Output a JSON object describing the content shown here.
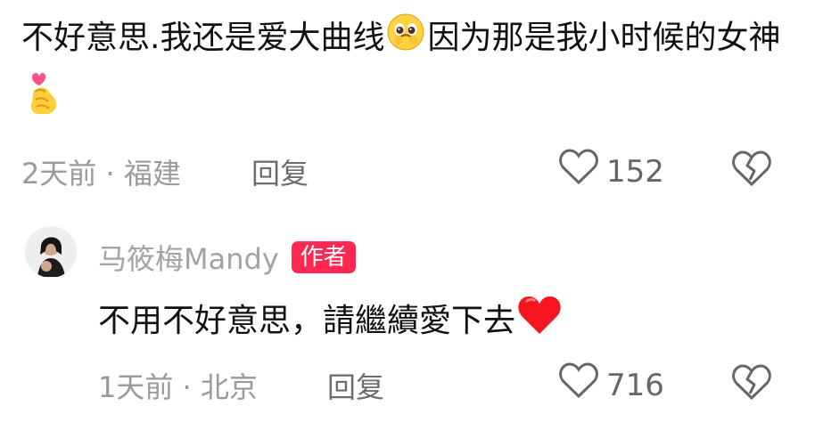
{
  "comment": {
    "text_part1": "不好意思.我还是爱大曲线",
    "text_part2": "因为那是我小时候的女神",
    "emoji_1": "pleading-face-icon",
    "emoji_2": "heart-hand-icon",
    "date": "2天前",
    "separator": "·",
    "location": "福建",
    "reply_label": "回复",
    "likes": "152"
  },
  "reply": {
    "author": "马筱梅Mandy",
    "badge": "作者",
    "text": "不用不好意思，請繼續愛下去",
    "emoji": "red-heart-icon",
    "date": "1天前",
    "separator": "·",
    "location": "北京",
    "reply_label": "回复",
    "likes": "716"
  },
  "colors": {
    "accent_badge": "#ff2852",
    "meta_text": "#9a9a9a"
  }
}
